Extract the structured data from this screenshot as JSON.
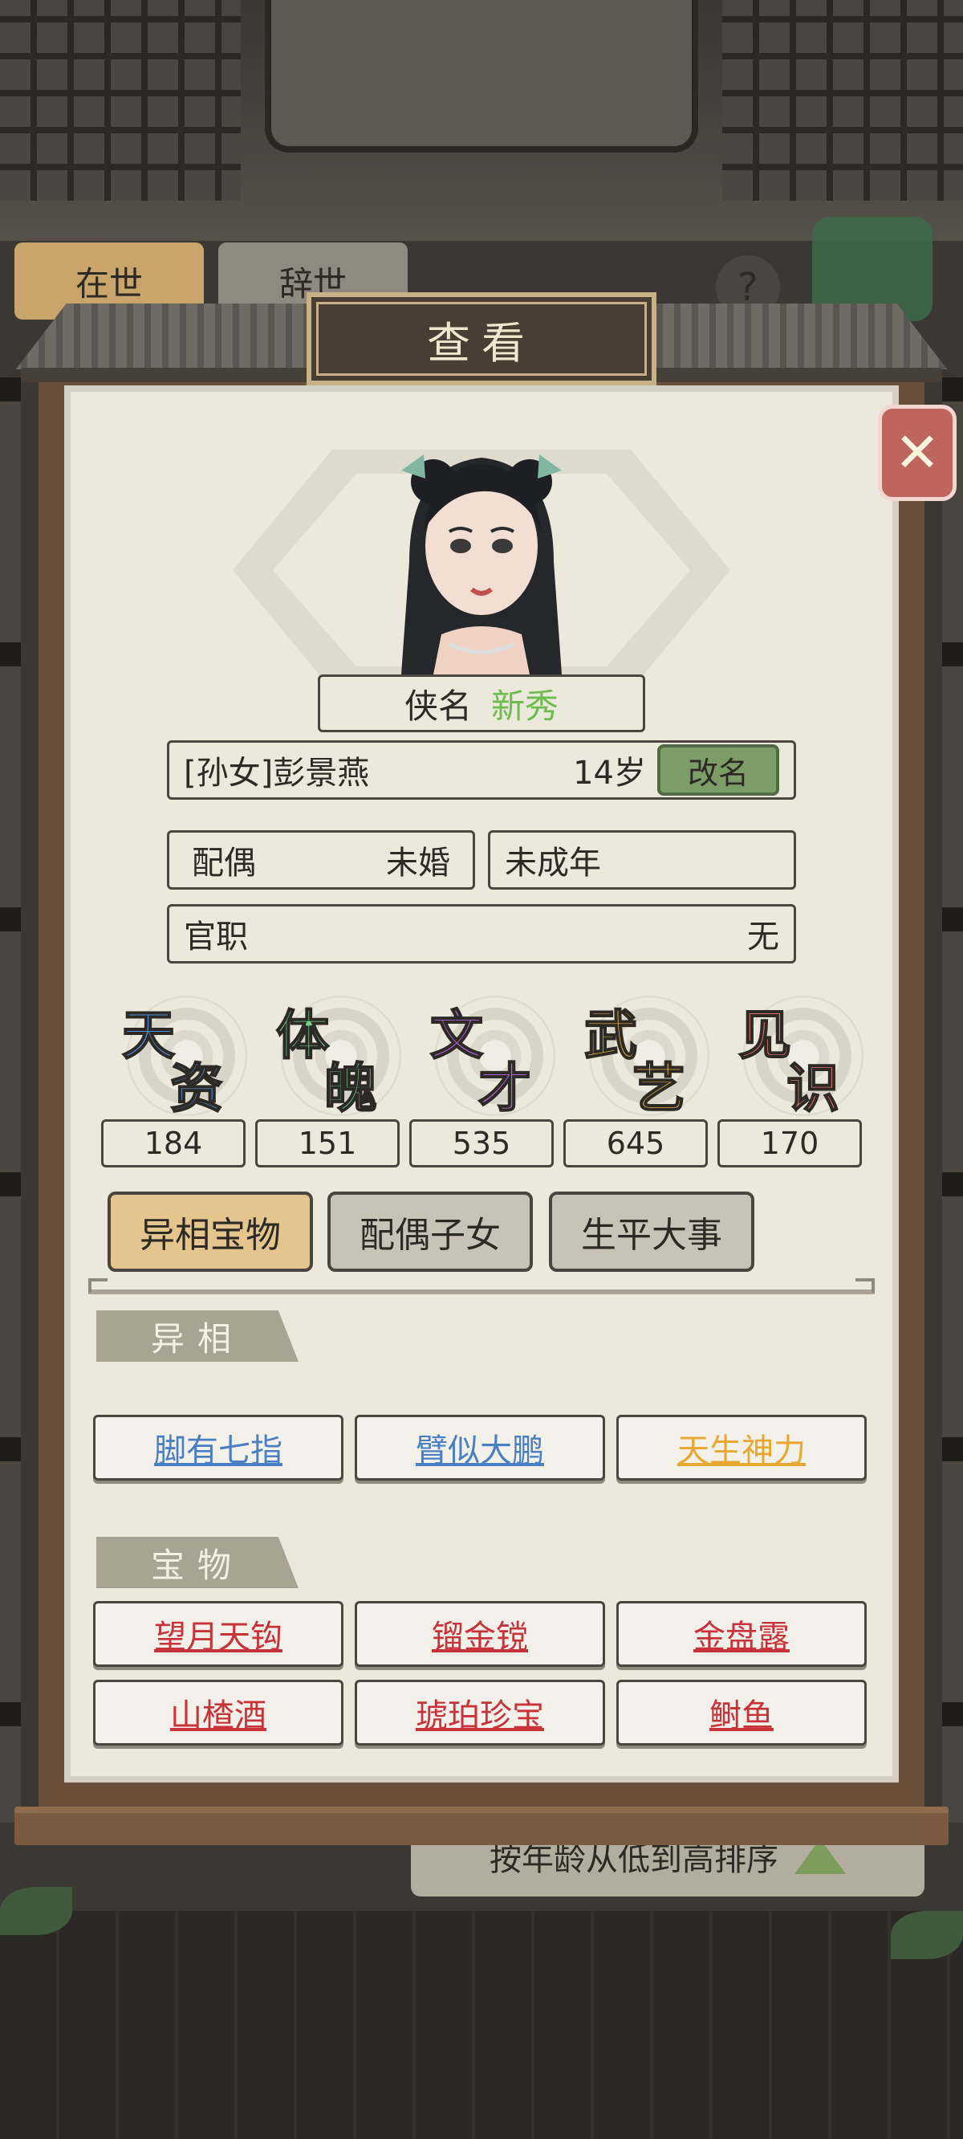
{
  "background": {
    "tab_alive": "在世",
    "tab_dead": "辞世",
    "help_label": "?",
    "sort_label": "按年龄从低到高排序"
  },
  "dialog": {
    "title": "查看",
    "close_icon": "close-x-icon"
  },
  "character": {
    "title_label": "侠名",
    "title_value": "新秀",
    "title_value_color": "#6dbd4e",
    "full_name": "[孙女]彭景燕",
    "age": "14岁",
    "rename_label": "改名",
    "spouse_label": "配偶",
    "spouse_value": "未婚",
    "adult_status": "未成年",
    "office_label": "官职",
    "office_value": "无"
  },
  "stats": [
    {
      "c1": "天",
      "c2": "资",
      "value": "184",
      "color": "#4f8de0"
    },
    {
      "c1": "体",
      "c2": "魄",
      "value": "151",
      "color": "#6fd08a"
    },
    {
      "c1": "文",
      "c2": "才",
      "value": "535",
      "color": "#b061d8"
    },
    {
      "c1": "武",
      "c2": "艺",
      "value": "645",
      "color": "#e9b348"
    },
    {
      "c1": "见",
      "c2": "识",
      "value": "170",
      "color": "#e0726a"
    }
  ],
  "tabs": [
    {
      "label": "异相宝物",
      "active": true
    },
    {
      "label": "配偶子女",
      "active": false
    },
    {
      "label": "生平大事",
      "active": false
    }
  ],
  "traits_section": {
    "title": "异相",
    "items": [
      {
        "label": "脚有七指",
        "color": "#4a7fc4"
      },
      {
        "label": "臂似大鹏",
        "color": "#4a7fc4"
      },
      {
        "label": "天生神力",
        "color": "#e8a832"
      }
    ]
  },
  "treasures_section": {
    "title": "宝物",
    "items": [
      {
        "label": "望月天钩",
        "color": "#c8333a"
      },
      {
        "label": "镏金镋",
        "color": "#c8333a"
      },
      {
        "label": "金盘露",
        "color": "#c8333a"
      },
      {
        "label": "山楂酒",
        "color": "#c8333a"
      },
      {
        "label": "琥珀珍宝",
        "color": "#c8333a"
      },
      {
        "label": "鲥鱼",
        "color": "#c8333a"
      }
    ]
  }
}
